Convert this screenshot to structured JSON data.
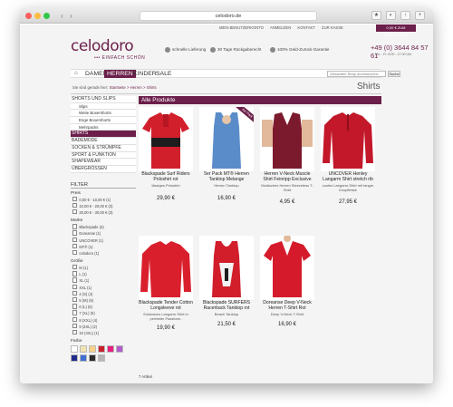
{
  "browser": {
    "url": "celodoro.de",
    "colors": {
      "close": "#fc605c",
      "min": "#fdbc40",
      "max": "#34c84a"
    }
  },
  "header": {
    "top_links": [
      "MEIN BENUTZERKONTO",
      "ANMELDEN",
      "KONTAKT",
      "ZUR KASSE"
    ],
    "cart_label": "0,00 € ZUM WARENKORB",
    "logo": "celodoro",
    "tagline": "••• EINFACH SCHÖN",
    "usps": [
      "schnelle Lieferung",
      "30 Tage Rückgaberecht",
      "100% Geld-Zurück-Garantie"
    ],
    "phone": "+49 (0) 3644 84 57 61",
    "phone_hours": "Mo. - Fr. 8.00 - 17.00 Uhr"
  },
  "nav": {
    "items": [
      "DAMEN",
      "HERREN",
      "KINDER",
      "SALE"
    ],
    "active": "HERREN",
    "search_placeholder": "Gesamten Shop durchsuchen...",
    "search_button": "Suche"
  },
  "breadcrumb": {
    "prefix": "Sie sind gerade hier:",
    "path": "Startseite > Herren > Shirts"
  },
  "page_title": "Shirts",
  "sidebar": {
    "categories": [
      {
        "label": "SHORTS UND SLIPS",
        "level": 0
      },
      {
        "label": "Slips",
        "level": 1
      },
      {
        "label": "Weite Boxershorts",
        "level": 1
      },
      {
        "label": "Enge Boxershorts",
        "level": 1
      },
      {
        "label": "Mehrpacks",
        "level": 1
      },
      {
        "label": "SHIRTS",
        "level": 0,
        "active": true
      },
      {
        "label": "BADEMODE",
        "level": 0
      },
      {
        "label": "SOCKEN & STRÜMPFE",
        "level": 0
      },
      {
        "label": "SPORT & FUNKTION",
        "level": 0
      },
      {
        "label": "SHAPEWEAR",
        "level": 0
      },
      {
        "label": "ÜBERGRÖSSEN",
        "level": 0
      }
    ],
    "filter_title": "FILTER",
    "price_label": "Preis",
    "prices": [
      "0,00 € - 10,00 € (1)",
      "10,00 € - 20,00 € (3)",
      "20,00 € - 30,00 € (3)"
    ],
    "brand_label": "Marke",
    "brands": [
      "Blackspade (3)",
      "Doreanse (1)",
      "UNCOVER (1)",
      "MT® (1)",
      "celodoro (1)"
    ],
    "size_label": "Größe",
    "sizes": [
      "M (1)",
      "L (1)",
      "XL (1)",
      "XXL (1)",
      "4 (S) (4)",
      "5 (M) (6)",
      "6 (L) (6)",
      "7 (XL) (5)",
      "8 (XXL) (4)",
      "9 (3XL) (2)",
      "10 (4XL) (1)"
    ],
    "color_label": "Farbe",
    "colors": [
      "#ffffff",
      "#f2e3b3",
      "#f7d08a",
      "#c8202b",
      "#e61f7d",
      "#b05ec9",
      "#1e2b8c",
      "#3f6fd1",
      "#2a2a2a",
      "#b7b7b7"
    ]
  },
  "main": {
    "heading": "Alle Produkte",
    "products": [
      {
        "name": "Blackspade Surf Riders Poloshirt rot",
        "desc": "lässiges Poloshirt",
        "price": "29,90 €",
        "icon": "red-polo-image"
      },
      {
        "name": "5er Pack MT® Herren Tanktop Melange",
        "desc": "Herren Tanktop",
        "price": "16,90 €",
        "icon": "blue-tanktop-image",
        "badge": "5er Pack"
      },
      {
        "name": "Herren V-Neck Muscle Shirt Feinripp Exclusive",
        "desc": "Modisches Herren Sleeveless T-Shirt",
        "price": "4,95 €",
        "icon": "maroon-muscle-shirt-image"
      },
      {
        "name": "UNCOVER Henley Langarm Shirt stretch rib",
        "desc": "cooles Langarm-Shirt mit langer Knopfleiste",
        "price": "27,95 €",
        "icon": "red-henley-image"
      },
      {
        "name": "Blackspade Tender Cotton Longsleeve rot",
        "desc": "Exklusives Langarm Shirt in perfekter Passform.",
        "price": "19,90 €",
        "icon": "red-longsleeve-image"
      },
      {
        "name": "Blackspade SURFERS Racerback Tanktop rot",
        "desc": "Beach Tanktop",
        "price": "21,50 €",
        "icon": "red-racerback-image"
      },
      {
        "name": "Doreanse Deep V-Neck Herren T-Shirt Rot",
        "desc": "Deep V-Neck T-Shirt",
        "price": "16,90 €",
        "icon": "red-vneck-tshirt-image"
      }
    ],
    "count_label": "7 Artikel"
  }
}
